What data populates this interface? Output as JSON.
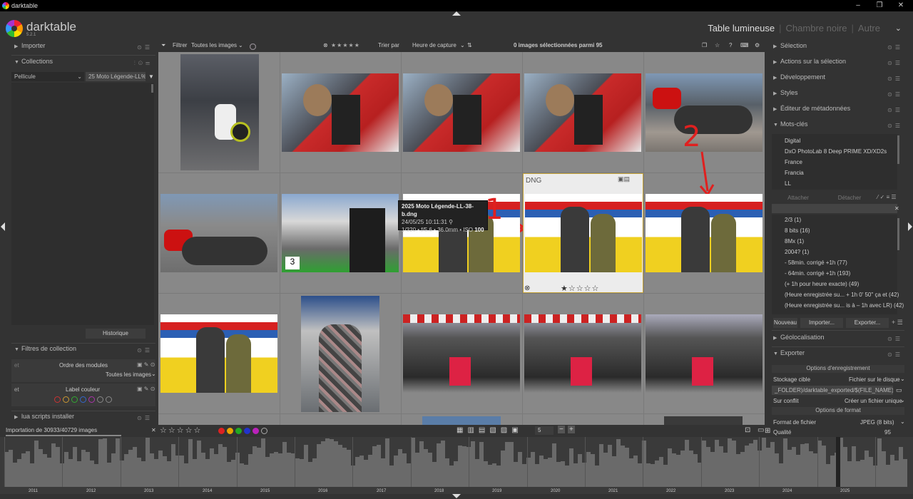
{
  "window": {
    "title": "darktable",
    "controls": [
      "–",
      "❐",
      "✕"
    ]
  },
  "header": {
    "app_name": "darktable",
    "version": "5.2.1",
    "views": [
      {
        "label": "Table lumineuse",
        "active": true
      },
      {
        "label": "Chambre noire"
      },
      {
        "label": "Autre"
      }
    ],
    "sep": "|",
    "chevron": "⌄"
  },
  "left": {
    "importer": "Importer",
    "collections": "Collections",
    "collection_type": "Pellicule",
    "collection_value": "25 Moto Légende-LL%",
    "historique": "Historique",
    "filtres_title": "Filtres de collection",
    "ordre_label": "Ordre des modules",
    "ordre_prefix": "et",
    "ordre_value": "Toutes les images",
    "label_prefix": "et",
    "label_couleur": "Label couleur",
    "lua": "lua scripts installer",
    "status": "Importation de 30933/40729 images",
    "status_close": "✕"
  },
  "toolbar": {
    "filter_label": "Filtrer",
    "filter_value": "Toutes les images",
    "sort_label": "Trier par",
    "sort_value": "Heure de capture",
    "selection_count": "0 images sélectionnées parmi 95",
    "stars": "★★★★★"
  },
  "grid": {
    "highlight": {
      "format": "DNG",
      "stars": "★☆☆☆☆",
      "reject": "⊗"
    },
    "annotations": {
      "one": "1",
      "two": "2"
    }
  },
  "tooltip": {
    "filename": "2025 Moto Légende-LL-38-b.dng",
    "datetime": "24/05/25 10:11:31",
    "exposure": "1/320 • f/5.6 • 36.0mm • ISO ",
    "iso": "100"
  },
  "right": {
    "sections": [
      "Sélection",
      "Actions sur la sélection",
      "Développement",
      "Styles",
      "Éditeur de métadonnées",
      "Mots-clés"
    ],
    "keywords": [
      "Digital",
      "DxO PhotoLab 8 Deep PRIME XD/XD2s",
      "France",
      "Francia",
      "LL"
    ],
    "attacher": "Attacher",
    "detacher": "Détacher",
    "tags": [
      "2/3 (1)",
      "8 bits (16)",
      "8Mx (1)",
      "2004? (1)",
      "- 58min. corrigé +1h (77)",
      "- 64min. corrigé +1h (193)",
      "(+ 1h pour heure exacte) (49)",
      "(Heure enregistrée su... + 1h 0' 50\" ça et (42)",
      "(Heure enregistrée su... is à – 1h avec LR) (42)"
    ],
    "nouveau": "Nouveau",
    "importer": "Importer...",
    "exporter_btn": "Exporter...",
    "geoloc": "Géolocalisation",
    "exporter": "Exporter",
    "options_enreg": "Options d'enregistrement",
    "stockage_label": "Stockage cible",
    "stockage_value": "Fichier sur le disque",
    "path_value": "_FOLDER)/darktable_exported/$(FILE_NAME)",
    "conflit_label": "Sur conflit",
    "conflit_value": "Créer un fichier unique",
    "options_format": "Options de format",
    "format_label": "Format de fichier",
    "format_value": "JPEG (8 bits)",
    "qualite_label": "Qualité",
    "qualite_value": "95"
  },
  "bottombar": {
    "stars": "☆☆☆☆☆",
    "zoom_value": "5",
    "minus": "−",
    "plus": "+"
  },
  "timeline": {
    "years": [
      "2011",
      "2012",
      "2013",
      "2014",
      "2015",
      "2016",
      "2017",
      "2018",
      "2019",
      "2020",
      "2021",
      "2022",
      "2023",
      "2024",
      "2025"
    ]
  },
  "colors": {
    "accent": "#c9a63a",
    "annotation": "#e0201f"
  }
}
